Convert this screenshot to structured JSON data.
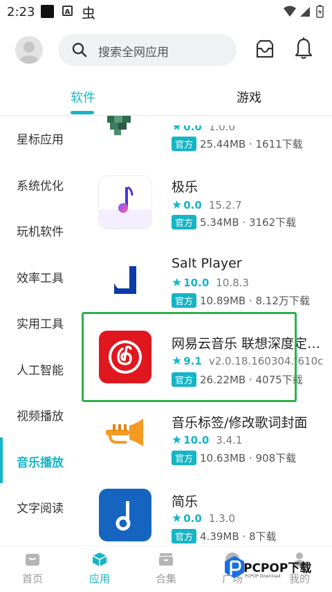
{
  "status_bar": {
    "time": "2:23",
    "notif_letter": "A",
    "notif_bug": "虫"
  },
  "header": {
    "search_placeholder": "搜索全网应用"
  },
  "tabs": [
    {
      "label": "软件"
    },
    {
      "label": "游戏"
    }
  ],
  "sidebar": {
    "items": [
      {
        "label": "星标应用"
      },
      {
        "label": "系统优化"
      },
      {
        "label": "玩机软件"
      },
      {
        "label": "效率工具"
      },
      {
        "label": "实用工具"
      },
      {
        "label": "人工智能"
      },
      {
        "label": "视频播放"
      },
      {
        "label": "音乐播放"
      },
      {
        "label": "文字阅读"
      }
    ],
    "active_index": 7
  },
  "apps": [
    {
      "name": "",
      "rating": "0.0",
      "version": "1.0.0",
      "badge": "官方",
      "meta": "25.44MB · 1611下载"
    },
    {
      "name": "极乐",
      "rating": "0.0",
      "version": "15.2.7",
      "badge": "官方",
      "meta": "5.34MB · 3162下载"
    },
    {
      "name": "Salt Player",
      "rating": "10.0",
      "version": "10.8.3",
      "badge": "官方",
      "meta": "10.89MB · 8.12万下载"
    },
    {
      "name": "网易云音乐 联想深度定制版",
      "rating": "9.1",
      "version": "v2.0.18.160304.f610c",
      "badge": "官方",
      "meta": "26.22MB · 4075下载"
    },
    {
      "name": "音乐标签/修改歌词封面",
      "rating": "10.0",
      "version": "3.4.1",
      "badge": "官方",
      "meta": "10.63MB · 908下载"
    },
    {
      "name": "简乐",
      "rating": "0.0",
      "version": "1.3.0",
      "badge": "官方",
      "meta": "4.39MB · 8下载"
    }
  ],
  "bottom_nav": [
    {
      "label": "首页",
      "icon": "home-icon"
    },
    {
      "label": "应用",
      "icon": "apps-cube-icon"
    },
    {
      "label": "合集",
      "icon": "collection-icon"
    },
    {
      "label": "广场",
      "icon": "square-icon"
    },
    {
      "label": "我的",
      "icon": "profile-icon"
    }
  ],
  "watermark": {
    "text": "PCPOP下载",
    "sub": "PCPOP Download"
  },
  "colors": {
    "accent": "#16b5c6",
    "highlight": "#2fb04a"
  }
}
